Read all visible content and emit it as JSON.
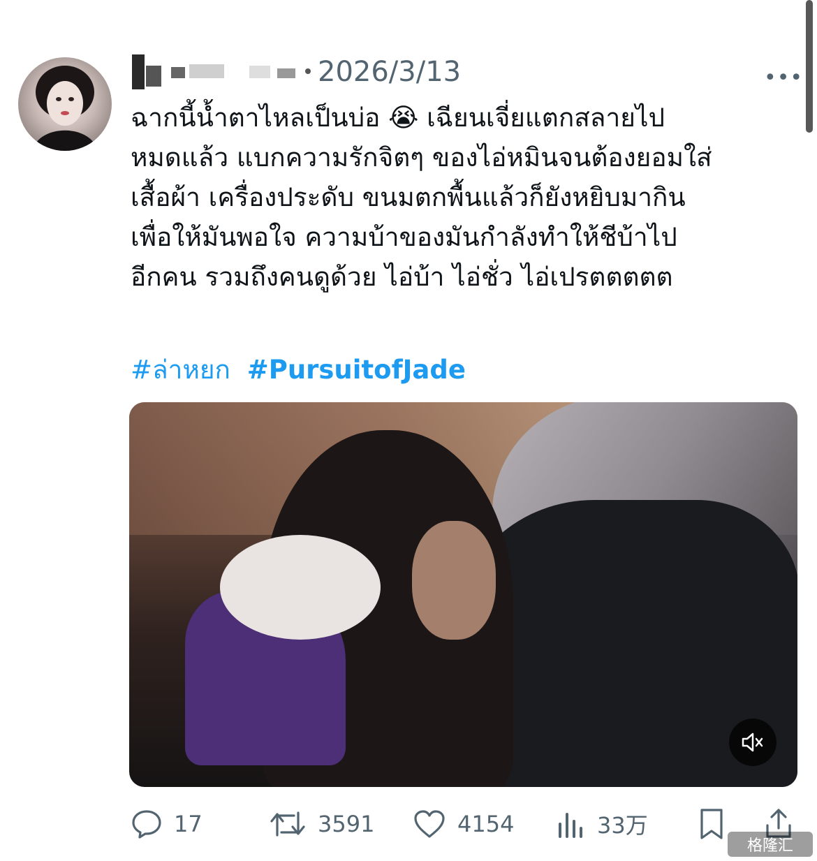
{
  "post": {
    "date": "2026/3/13",
    "more_label": "•••",
    "text_lines": [
      "ฉากนี้น้ำตาไหลเป็นบ่อ 😭 เฉียนเจี่ยแตกสลายไป",
      "หมดแล้ว แบกความรักจิตๆ ของไอ่หมินจนต้องยอมใส่",
      "เสื้อผ้า เครื่องประดับ ขนมตกพื้นแล้วก็ยังหยิบมากิน",
      "เพื่อให้มันพอใจ ความบ้าของมันกำลังทำให้ชีบ้าไป",
      "อีกคน รวมถึงคนดูด้วย ไอ่บ้า ไอ่ชั่ว ไอ่เปรตตตตต"
    ],
    "hashtags": [
      "#ล่าหยก",
      "#PursuitofJade"
    ]
  },
  "media": {
    "mute_icon": "speaker-muted-icon",
    "mute_label": "🔇"
  },
  "actions": {
    "reply_count": "17",
    "repost_count": "3591",
    "like_count": "4154",
    "views_count": "33万"
  },
  "watermark": "格隆汇",
  "colors": {
    "accent": "#1d9bf0",
    "muted": "#536471"
  }
}
